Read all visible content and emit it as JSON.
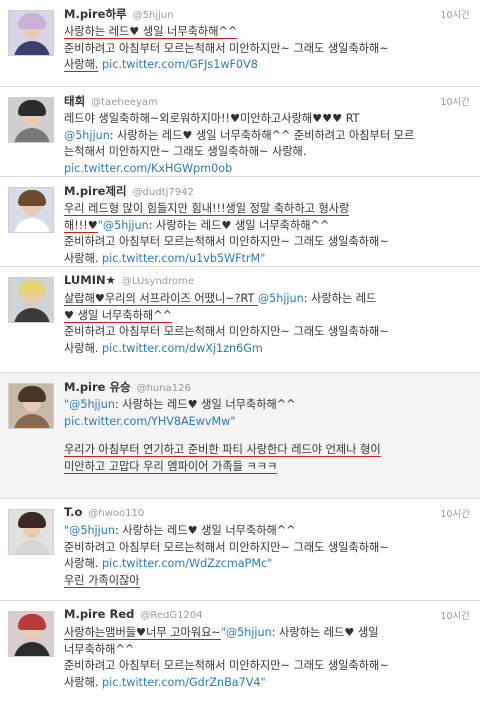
{
  "tweets": [
    {
      "name": "M.pire하루",
      "handle": "@5hjjun",
      "time": "10시간",
      "avatar": {
        "hair": "#c9b1d6",
        "clothes": "#3a3f6e",
        "bg": "#d8d4e6"
      },
      "lines": [
        [
          {
            "t": "사랑하는 레드♥ 생일 너무축하해^^",
            "c": "text",
            "u": true
          }
        ],
        [
          {
            "t": "준비하려고 아침부터 모르는척해서 미안하지만~ 그래도 생일축하해~",
            "c": "text"
          }
        ],
        [
          {
            "t": "사랑해.",
            "c": "text",
            "u": true
          },
          {
            "t": " pic.twitter.com/GFJs1wF0V8",
            "c": "link"
          }
        ]
      ]
    },
    {
      "name": "태희",
      "handle": "@taeheeyam",
      "time": "10시간",
      "avatar": {
        "hair": "#2b2b2b",
        "clothes": "#7a7a7a",
        "bg": "#cfcfcf"
      },
      "lines": [
        [
          {
            "t": "레드야 생일축하해~외로워하지마!!♥미안하고사랑해♥♥♥ RT",
            "c": "text"
          }
        ],
        [
          {
            "t": "@5hjjun",
            "c": "mention"
          },
          {
            "t": ": 사랑하는 레드♥ 생일 너무축하해^^ 준비하려고 아침부터 모르",
            "c": "text"
          }
        ],
        [
          {
            "t": "는척해서 미안하지만~ 그래도 생일축하해~ 사랑해.",
            "c": "text"
          }
        ],
        [
          {
            "t": "pic.twitter.com/KxHGWpm0ob",
            "c": "link"
          }
        ]
      ]
    },
    {
      "name": "M.pire제리",
      "handle": "@dudtj7942",
      "time": "",
      "avatar": {
        "hair": "#6b4b2a",
        "clothes": "#ffffff",
        "bg": "#d6dde8"
      },
      "lines": [
        [
          {
            "t": "우리 레드형 많이 힘들지만 힘내!!!생일 정말 축하하고 형사랑",
            "c": "text",
            "u": true
          }
        ],
        [
          {
            "t": "해!!!♥",
            "c": "text",
            "u": true
          },
          {
            "t": "\"@5hjjun",
            "c": "mention"
          },
          {
            "t": ": 사랑하는 레드♥ 생일 너무축하해^^",
            "c": "text"
          }
        ],
        [
          {
            "t": "준비하려고 아침부터 모르는척해서 미안하지만~ 그래도 생일축하해~",
            "c": "text"
          }
        ],
        [
          {
            "t": "사랑해. ",
            "c": "text"
          },
          {
            "t": "pic.twitter.com/u1vb5WFtrM\"",
            "c": "link"
          }
        ]
      ]
    },
    {
      "name": "LUMIN★",
      "handle": "@LUsyndrome",
      "time": "",
      "avatar": {
        "hair": "#e6d27a",
        "clothes": "#3b3b3b",
        "bg": "#cfd4d8"
      },
      "lines": [
        [
          {
            "t": "살랍해♥우리의 서프라이즈 어땠니~?RT ",
            "c": "text",
            "u": true
          },
          {
            "t": "@5hjjun",
            "c": "mention"
          },
          {
            "t": ": 사랑하는 레드",
            "c": "text"
          }
        ],
        [
          {
            "t": "♥ 생일 너무축하해^^",
            "c": "text",
            "u": true
          }
        ],
        [
          {
            "t": "준비하려고 아침부터 모르는척해서 미안하지만~ 그래도 생일축하해~",
            "c": "text"
          }
        ],
        [
          {
            "t": "사랑해. ",
            "c": "text"
          },
          {
            "t": "pic.twitter.com/dwXj1zn6Gm",
            "c": "link"
          }
        ]
      ]
    },
    {
      "name": "M.pire 유승",
      "handle": "@huna126",
      "time": "",
      "avatar": {
        "hair": "#4a3528",
        "clothes": "#8a6a4e",
        "bg": "#c8b8a6"
      },
      "lines": [
        [
          {
            "t": "\"@5hjjun",
            "c": "mention"
          },
          {
            "t": ": 사랑하는 레드♥ 생일 너무축하해^^",
            "c": "text"
          }
        ],
        [
          {
            "t": "pic.twitter.com/YHV8AEwvMw\"",
            "c": "link"
          }
        ],
        [],
        [
          {
            "t": "우리가 아침부터 연기하고 준비한 파티 사랑한다 레드야 언제나 형이",
            "c": "text",
            "u": true
          }
        ],
        [
          {
            "t": "미안하고 고맙다 우리 엠파이어 가족들 ㅋㅋㅋ",
            "c": "text",
            "u": true
          }
        ]
      ]
    },
    {
      "name": "T.o",
      "handle": "@hwoo110",
      "time": "10시간",
      "avatar": {
        "hair": "#3a2a22",
        "clothes": "#d8d8d8",
        "bg": "#e4e0dc"
      },
      "lines": [
        [
          {
            "t": "\"@5hjjun",
            "c": "mention"
          },
          {
            "t": ": 사랑하는 레드♥ 생일 너무축하해^^",
            "c": "text"
          }
        ],
        [
          {
            "t": "준비하려고 아침부터 모르는척해서 미안하지만~ 그래도 생일축하해~",
            "c": "text"
          }
        ],
        [
          {
            "t": "사랑해. ",
            "c": "text"
          },
          {
            "t": "pic.twitter.com/WdZzcmaPMc\"",
            "c": "link"
          }
        ],
        [
          {
            "t": "우린 가족이잖아",
            "c": "text",
            "u": true
          }
        ]
      ]
    },
    {
      "name": "M.pire Red",
      "handle": "@RedG1204",
      "time": "10시간",
      "avatar": {
        "hair": "#b83a3a",
        "clothes": "#2c2c2c",
        "bg": "#d9cccc"
      },
      "lines": [
        [
          {
            "t": "사랑하는맴버들♥너무 고마워요~",
            "c": "text",
            "u": true
          },
          {
            "t": "\"@5hjjun",
            "c": "mention"
          },
          {
            "t": ": 사랑하는 레드♥ 생일",
            "c": "text"
          }
        ],
        [
          {
            "t": "너무축하해^^",
            "c": "text"
          }
        ],
        [
          {
            "t": "준비하려고 아침부터 모르는척해서 미안하지만~ 그래도 생일축하해~",
            "c": "text"
          }
        ],
        [
          {
            "t": "사랑해. ",
            "c": "text"
          },
          {
            "t": "pic.twitter.com/GdrZnBa7V4\"",
            "c": "link"
          }
        ]
      ]
    }
  ]
}
